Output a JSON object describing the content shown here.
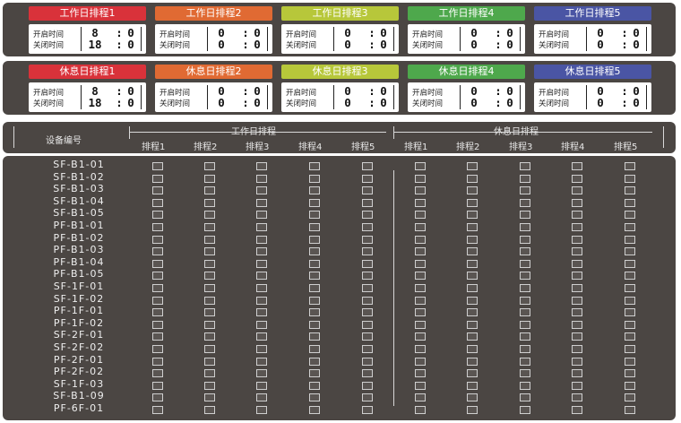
{
  "work_schedules": [
    {
      "title": "工作日排程1",
      "color": "#d9323a",
      "open_label": "开启时间",
      "close_label": "关闭时间",
      "open_hour": "8",
      "open_min": "0",
      "close_hour": "18",
      "close_min": "0"
    },
    {
      "title": "工作日排程2",
      "color": "#e06a33",
      "open_label": "开启时间",
      "close_label": "关闭时间",
      "open_hour": "0",
      "open_min": "0",
      "close_hour": "0",
      "close_min": "0"
    },
    {
      "title": "工作日排程3",
      "color": "#b7c73a",
      "open_label": "开启时间",
      "close_label": "关闭时间",
      "open_hour": "0",
      "open_min": "0",
      "close_hour": "0",
      "close_min": "0"
    },
    {
      "title": "工作日排程4",
      "color": "#4ea84c",
      "open_label": "开启时间",
      "close_label": "关闭时间",
      "open_hour": "0",
      "open_min": "0",
      "close_hour": "0",
      "close_min": "0"
    },
    {
      "title": "工作日排程5",
      "color": "#4a55a4",
      "open_label": "开启时间",
      "close_label": "关闭时间",
      "open_hour": "0",
      "open_min": "0",
      "close_hour": "0",
      "close_min": "0"
    }
  ],
  "rest_schedules": [
    {
      "title": "休息日排程1",
      "color": "#d9323a",
      "open_label": "开启时间",
      "close_label": "关闭时间",
      "open_hour": "8",
      "open_min": "0",
      "close_hour": "18",
      "close_min": "0"
    },
    {
      "title": "休息日排程2",
      "color": "#e06a33",
      "open_label": "开启时间",
      "close_label": "关闭时间",
      "open_hour": "0",
      "open_min": "0",
      "close_hour": "0",
      "close_min": "0"
    },
    {
      "title": "休息日排程3",
      "color": "#b7c73a",
      "open_label": "开启时间",
      "close_label": "关闭时间",
      "open_hour": "0",
      "open_min": "0",
      "close_hour": "0",
      "close_min": "0"
    },
    {
      "title": "休息日排程4",
      "color": "#4ea84c",
      "open_label": "开启时间",
      "close_label": "关闭时间",
      "open_hour": "0",
      "open_min": "0",
      "close_hour": "0",
      "close_min": "0"
    },
    {
      "title": "休息日排程5",
      "color": "#4a55a4",
      "open_label": "开启时间",
      "close_label": "关闭时间",
      "open_hour": "0",
      "open_min": "0",
      "close_hour": "0",
      "close_min": "0"
    }
  ],
  "time_separator": ":",
  "table_header": {
    "device_label": "设备编号",
    "work_group": "工作日排程",
    "rest_group": "休息日排程",
    "work_columns": [
      "排程1",
      "排程2",
      "排程3",
      "排程4",
      "排程5"
    ],
    "rest_columns": [
      "排程1",
      "排程2",
      "排程3",
      "排程4",
      "排程5"
    ]
  },
  "devices": [
    "SF-B1-01",
    "SF-B1-02",
    "SF-B1-03",
    "SF-B1-04",
    "SF-B1-05",
    "PF-B1-01",
    "PF-B1-02",
    "PF-B1-03",
    "PF-B1-04",
    "PF-B1-05",
    "SF-1F-01",
    "SF-1F-02",
    "PF-1F-01",
    "PF-1F-02",
    "SF-2F-01",
    "SF-2F-02",
    "PF-2F-01",
    "PF-2F-02",
    "SF-1F-03",
    "SF-B1-09",
    "PF-6F-01"
  ]
}
